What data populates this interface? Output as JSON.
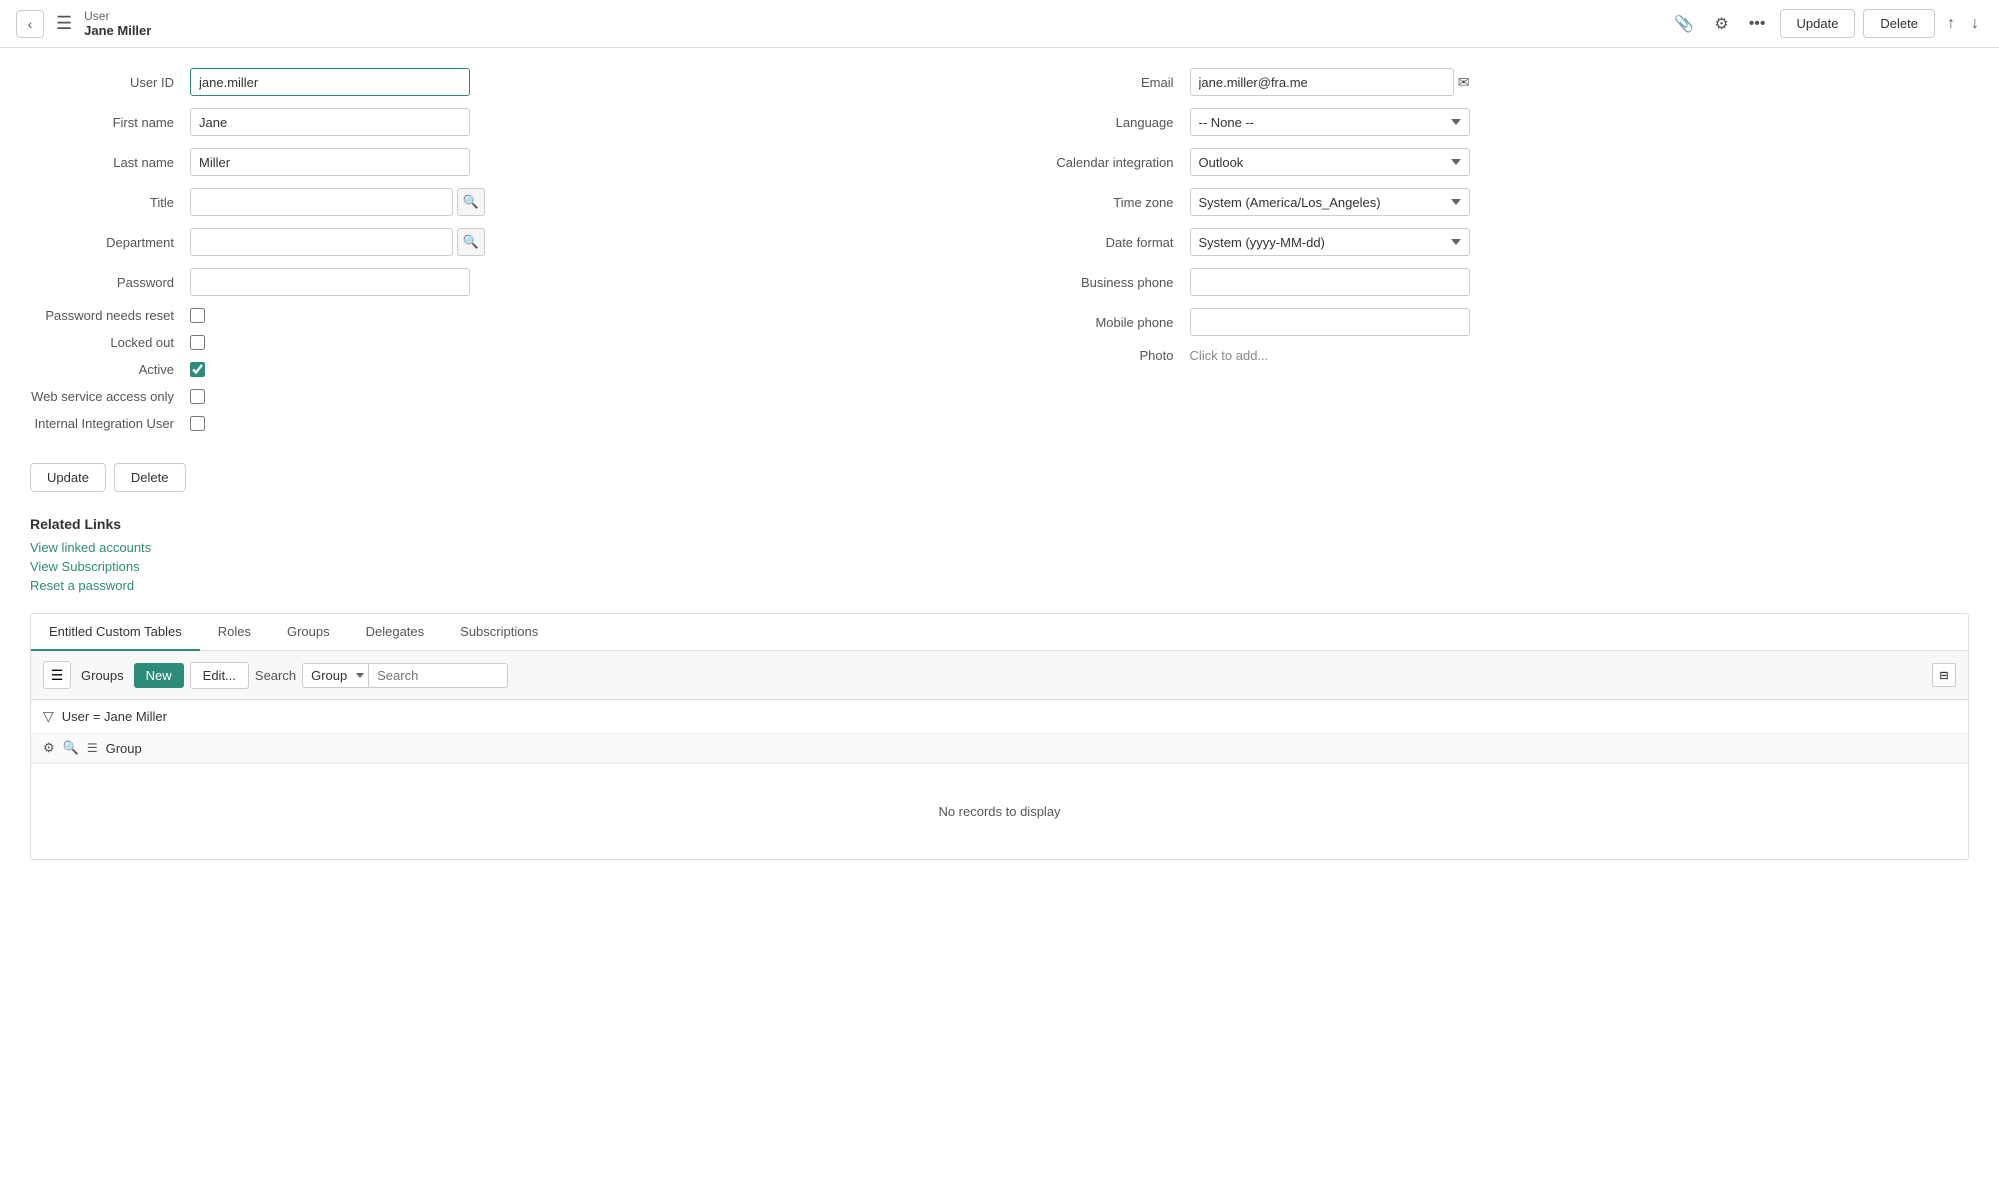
{
  "topbar": {
    "back_label": "‹",
    "menu_icon": "☰",
    "title_main": "User",
    "title_sub": "Jane Miller",
    "attach_icon": "📎",
    "settings_icon": "⚙",
    "more_icon": "•••",
    "update_label": "Update",
    "delete_label": "Delete",
    "arrow_up": "↑",
    "arrow_down": "↓"
  },
  "form": {
    "left": {
      "user_id_label": "User ID",
      "user_id_value": "jane.miller",
      "first_name_label": "First name",
      "first_name_value": "Jane",
      "last_name_label": "Last name",
      "last_name_value": "Miller",
      "title_label": "Title",
      "title_value": "",
      "department_label": "Department",
      "department_value": "",
      "password_label": "Password",
      "password_value": "",
      "pwd_reset_label": "Password needs reset",
      "locked_out_label": "Locked out",
      "active_label": "Active",
      "web_service_label": "Web service access only",
      "internal_integration_label": "Internal Integration User"
    },
    "right": {
      "email_label": "Email",
      "email_value": "jane.miller@fra.me",
      "language_label": "Language",
      "language_value": "-- None --",
      "calendar_label": "Calendar integration",
      "calendar_value": "Outlook",
      "timezone_label": "Time zone",
      "timezone_value": "System (America/Los_Angeles)",
      "date_format_label": "Date format",
      "date_format_value": "System (yyyy-MM-dd)",
      "business_phone_label": "Business phone",
      "business_phone_value": "",
      "mobile_phone_label": "Mobile phone",
      "mobile_phone_value": "",
      "photo_label": "Photo",
      "photo_placeholder": "Click to add..."
    }
  },
  "buttons": {
    "update": "Update",
    "delete": "Delete"
  },
  "related_links": {
    "heading": "Related Links",
    "links": [
      "View linked accounts",
      "View Subscriptions",
      "Reset a password"
    ]
  },
  "tabs": {
    "items": [
      {
        "label": "Entitled Custom Tables",
        "active": true
      },
      {
        "label": "Roles",
        "active": false
      },
      {
        "label": "Groups",
        "active": false
      },
      {
        "label": "Delegates",
        "active": false
      },
      {
        "label": "Subscriptions",
        "active": false
      }
    ]
  },
  "tab_toolbar": {
    "menu_icon": "☰",
    "groups_label": "Groups",
    "new_label": "New",
    "edit_label": "Edit...",
    "search_label": "Search",
    "search_group_option": "Group",
    "search_placeholder": "Search",
    "collapse_icon": "⊟"
  },
  "filter": {
    "filter_icon": "▽",
    "filter_text": "User = Jane Miller"
  },
  "col_header": {
    "settings_icon": "⚙",
    "search_icon": "🔍",
    "menu_icon": "☰",
    "group_label": "Group"
  },
  "no_records": {
    "message": "No records to display"
  }
}
